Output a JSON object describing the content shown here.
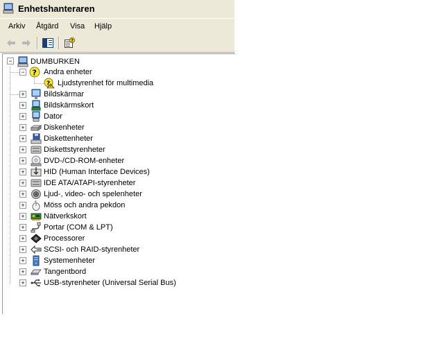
{
  "window": {
    "title": "Enhetshanteraren"
  },
  "menu": [
    "Arkiv",
    "Åtgärd",
    "Visa",
    "Hjälp"
  ],
  "toolbar": {
    "buttons": [
      "back-icon",
      "forward-icon",
      "console-tree-icon",
      "properties-icon"
    ]
  },
  "tree": {
    "root": {
      "label": "DUMBURKEN",
      "icon": "computer-icon",
      "expander": "−"
    },
    "categories": [
      {
        "label": "Andra enheter",
        "icon": "unknown-device-icon",
        "expander": "−",
        "children": [
          {
            "label": "Ljudstyrenhet för multimedia",
            "icon": "warning-device-icon"
          }
        ]
      },
      {
        "label": "Bildskärmar",
        "icon": "monitor-icon",
        "expander": "+"
      },
      {
        "label": "Bildskärmskort",
        "icon": "display-adapter-icon",
        "expander": "+"
      },
      {
        "label": "Dator",
        "icon": "computer-icon",
        "expander": "+"
      },
      {
        "label": "Diskenheter",
        "icon": "disk-drive-icon",
        "expander": "+"
      },
      {
        "label": "Diskettenheter",
        "icon": "floppy-icon",
        "expander": "+"
      },
      {
        "label": "Diskettstyrenheter",
        "icon": "floppy-controller-icon",
        "expander": "+"
      },
      {
        "label": "DVD-/CD-ROM-enheter",
        "icon": "cdrom-icon",
        "expander": "+"
      },
      {
        "label": "HID (Human Interface Devices)",
        "icon": "hid-icon",
        "expander": "+"
      },
      {
        "label": "IDE ATA/ATAPI-styrenheter",
        "icon": "ide-controller-icon",
        "expander": "+"
      },
      {
        "label": "Ljud-, video- och spelenheter",
        "icon": "sound-icon",
        "expander": "+"
      },
      {
        "label": "Möss och andra pekdon",
        "icon": "mouse-icon",
        "expander": "+"
      },
      {
        "label": "Nätverkskort",
        "icon": "network-card-icon",
        "expander": "+"
      },
      {
        "label": "Portar (COM & LPT)",
        "icon": "port-icon",
        "expander": "+"
      },
      {
        "label": "Processorer",
        "icon": "processor-icon",
        "expander": "+"
      },
      {
        "label": "SCSI- och RAID-styrenheter",
        "icon": "scsi-icon",
        "expander": "+"
      },
      {
        "label": "Systemenheter",
        "icon": "system-device-icon",
        "expander": "+"
      },
      {
        "label": "Tangentbord",
        "icon": "keyboard-icon",
        "expander": "+"
      },
      {
        "label": "USB-styrenheter (Universal Serial Bus)",
        "icon": "usb-icon",
        "expander": "+"
      }
    ]
  }
}
